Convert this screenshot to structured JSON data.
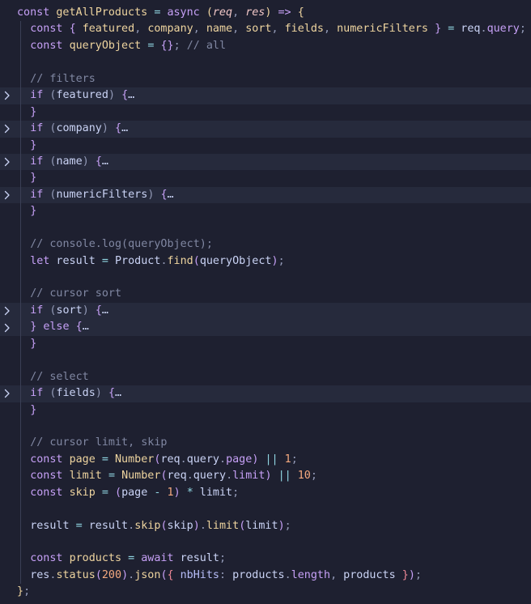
{
  "colors": {
    "background": "#1e2030",
    "keyword": "#c6a0f6",
    "function": "#eed49f",
    "comment": "#8087a2",
    "number": "#f5a97f",
    "text": "#cad3f5"
  },
  "lines": [
    {
      "folded": false,
      "guide": false,
      "indent": 0,
      "tokens": [
        [
          "t-keyword",
          "const"
        ],
        [
          "t-plain",
          " "
        ],
        [
          "t-func",
          "getAllProducts"
        ],
        [
          "t-plain",
          " "
        ],
        [
          "t-op",
          "="
        ],
        [
          "t-plain",
          " "
        ],
        [
          "t-keyword",
          "async"
        ],
        [
          "t-plain",
          " "
        ],
        [
          "t-brace-top",
          "("
        ],
        [
          "t-param",
          "req"
        ],
        [
          "t-punct",
          ", "
        ],
        [
          "t-param",
          "res"
        ],
        [
          "t-brace-top",
          ")"
        ],
        [
          "t-plain",
          " "
        ],
        [
          "t-keyword",
          "=>"
        ],
        [
          "t-plain",
          " "
        ],
        [
          "t-brace-top",
          "{"
        ]
      ]
    },
    {
      "folded": false,
      "guide": true,
      "indent": 1,
      "tokens": [
        [
          "t-keyword",
          "const"
        ],
        [
          "t-plain",
          " "
        ],
        [
          "t-brace",
          "{"
        ],
        [
          "t-plain",
          " "
        ],
        [
          "t-const-name",
          "featured"
        ],
        [
          "t-punct",
          ", "
        ],
        [
          "t-const-name",
          "company"
        ],
        [
          "t-punct",
          ", "
        ],
        [
          "t-const-name",
          "name"
        ],
        [
          "t-punct",
          ", "
        ],
        [
          "t-const-name",
          "sort"
        ],
        [
          "t-punct",
          ", "
        ],
        [
          "t-const-name",
          "fields"
        ],
        [
          "t-punct",
          ", "
        ],
        [
          "t-const-name",
          "numericFilters"
        ],
        [
          "t-plain",
          " "
        ],
        [
          "t-brace",
          "}"
        ],
        [
          "t-plain",
          " "
        ],
        [
          "t-op",
          "="
        ],
        [
          "t-plain",
          " req"
        ],
        [
          "t-punct",
          "."
        ],
        [
          "t-prop",
          "query"
        ],
        [
          "t-punct",
          ";"
        ]
      ]
    },
    {
      "folded": false,
      "guide": true,
      "indent": 1,
      "tokens": [
        [
          "t-keyword",
          "const"
        ],
        [
          "t-plain",
          " "
        ],
        [
          "t-const-name",
          "queryObject"
        ],
        [
          "t-plain",
          " "
        ],
        [
          "t-op",
          "="
        ],
        [
          "t-plain",
          " "
        ],
        [
          "t-brace",
          "{}"
        ],
        [
          "t-punct",
          ";"
        ],
        [
          "t-plain",
          " "
        ],
        [
          "t-comment",
          "// all"
        ]
      ]
    },
    {
      "folded": false,
      "guide": true,
      "indent": 1,
      "tokens": []
    },
    {
      "folded": false,
      "guide": true,
      "indent": 1,
      "tokens": [
        [
          "t-comment",
          "// filters"
        ]
      ]
    },
    {
      "folded": true,
      "guide": true,
      "indent": 1,
      "tokens": [
        [
          "t-keyword",
          "if"
        ],
        [
          "t-plain",
          " "
        ],
        [
          "t-punct",
          "("
        ],
        [
          "t-plain",
          "featured"
        ],
        [
          "t-punct",
          ")"
        ],
        [
          "t-plain",
          " "
        ],
        [
          "t-brace",
          "{"
        ],
        [
          "t-ellipsis",
          "…"
        ]
      ]
    },
    {
      "folded": false,
      "guide": true,
      "indent": 1,
      "tokens": [
        [
          "t-brace",
          "}"
        ]
      ]
    },
    {
      "folded": true,
      "guide": true,
      "indent": 1,
      "tokens": [
        [
          "t-keyword",
          "if"
        ],
        [
          "t-plain",
          " "
        ],
        [
          "t-punct",
          "("
        ],
        [
          "t-plain",
          "company"
        ],
        [
          "t-punct",
          ")"
        ],
        [
          "t-plain",
          " "
        ],
        [
          "t-brace",
          "{"
        ],
        [
          "t-ellipsis",
          "…"
        ]
      ]
    },
    {
      "folded": false,
      "guide": true,
      "indent": 1,
      "tokens": [
        [
          "t-brace",
          "}"
        ]
      ]
    },
    {
      "folded": true,
      "guide": true,
      "indent": 1,
      "tokens": [
        [
          "t-keyword",
          "if"
        ],
        [
          "t-plain",
          " "
        ],
        [
          "t-punct",
          "("
        ],
        [
          "t-plain",
          "name"
        ],
        [
          "t-punct",
          ")"
        ],
        [
          "t-plain",
          " "
        ],
        [
          "t-brace",
          "{"
        ],
        [
          "t-ellipsis",
          "…"
        ]
      ]
    },
    {
      "folded": false,
      "guide": true,
      "indent": 1,
      "tokens": [
        [
          "t-brace",
          "}"
        ]
      ]
    },
    {
      "folded": true,
      "guide": true,
      "indent": 1,
      "tokens": [
        [
          "t-keyword",
          "if"
        ],
        [
          "t-plain",
          " "
        ],
        [
          "t-punct",
          "("
        ],
        [
          "t-plain",
          "numericFilters"
        ],
        [
          "t-punct",
          ")"
        ],
        [
          "t-plain",
          " "
        ],
        [
          "t-brace",
          "{"
        ],
        [
          "t-ellipsis",
          "…"
        ]
      ]
    },
    {
      "folded": false,
      "guide": true,
      "indent": 1,
      "tokens": [
        [
          "t-brace",
          "}"
        ]
      ]
    },
    {
      "folded": false,
      "guide": true,
      "indent": 1,
      "tokens": []
    },
    {
      "folded": false,
      "guide": true,
      "indent": 1,
      "tokens": [
        [
          "t-comment",
          "// console.log(queryObject);"
        ]
      ]
    },
    {
      "folded": false,
      "guide": true,
      "indent": 1,
      "tokens": [
        [
          "t-keyword",
          "let"
        ],
        [
          "t-plain",
          " result "
        ],
        [
          "t-op",
          "="
        ],
        [
          "t-plain",
          " Product"
        ],
        [
          "t-punct",
          "."
        ],
        [
          "t-func",
          "find"
        ],
        [
          "t-brace",
          "("
        ],
        [
          "t-plain",
          "queryObject"
        ],
        [
          "t-brace",
          ")"
        ],
        [
          "t-punct",
          ";"
        ]
      ]
    },
    {
      "folded": false,
      "guide": true,
      "indent": 1,
      "tokens": []
    },
    {
      "folded": false,
      "guide": true,
      "indent": 1,
      "tokens": [
        [
          "t-comment",
          "// cursor sort"
        ]
      ]
    },
    {
      "folded": true,
      "guide": true,
      "indent": 1,
      "tokens": [
        [
          "t-keyword",
          "if"
        ],
        [
          "t-plain",
          " "
        ],
        [
          "t-punct",
          "("
        ],
        [
          "t-plain",
          "sort"
        ],
        [
          "t-punct",
          ")"
        ],
        [
          "t-plain",
          " "
        ],
        [
          "t-brace",
          "{"
        ],
        [
          "t-ellipsis",
          "…"
        ]
      ]
    },
    {
      "folded": true,
      "guide": true,
      "indent": 1,
      "tokens": [
        [
          "t-brace",
          "}"
        ],
        [
          "t-plain",
          " "
        ],
        [
          "t-keyword",
          "else"
        ],
        [
          "t-plain",
          " "
        ],
        [
          "t-brace",
          "{"
        ],
        [
          "t-ellipsis",
          "…"
        ]
      ]
    },
    {
      "folded": false,
      "guide": true,
      "indent": 1,
      "tokens": [
        [
          "t-brace",
          "}"
        ]
      ]
    },
    {
      "folded": false,
      "guide": true,
      "indent": 1,
      "tokens": []
    },
    {
      "folded": false,
      "guide": true,
      "indent": 1,
      "tokens": [
        [
          "t-comment",
          "// select"
        ]
      ]
    },
    {
      "folded": true,
      "guide": true,
      "indent": 1,
      "tokens": [
        [
          "t-keyword",
          "if"
        ],
        [
          "t-plain",
          " "
        ],
        [
          "t-punct",
          "("
        ],
        [
          "t-plain",
          "fields"
        ],
        [
          "t-punct",
          ")"
        ],
        [
          "t-plain",
          " "
        ],
        [
          "t-brace",
          "{"
        ],
        [
          "t-ellipsis",
          "…"
        ]
      ]
    },
    {
      "folded": false,
      "guide": true,
      "indent": 1,
      "tokens": [
        [
          "t-brace",
          "}"
        ]
      ]
    },
    {
      "folded": false,
      "guide": true,
      "indent": 1,
      "tokens": []
    },
    {
      "folded": false,
      "guide": true,
      "indent": 1,
      "tokens": [
        [
          "t-comment",
          "// cursor limit, skip"
        ]
      ]
    },
    {
      "folded": false,
      "guide": true,
      "indent": 1,
      "tokens": [
        [
          "t-keyword",
          "const"
        ],
        [
          "t-plain",
          " "
        ],
        [
          "t-const-name",
          "page"
        ],
        [
          "t-plain",
          " "
        ],
        [
          "t-op",
          "="
        ],
        [
          "t-plain",
          " "
        ],
        [
          "t-func",
          "Number"
        ],
        [
          "t-brace",
          "("
        ],
        [
          "t-plain",
          "req"
        ],
        [
          "t-punct",
          "."
        ],
        [
          "t-plain",
          "query"
        ],
        [
          "t-punct",
          "."
        ],
        [
          "t-prop",
          "page"
        ],
        [
          "t-brace",
          ")"
        ],
        [
          "t-plain",
          " "
        ],
        [
          "t-op",
          "||"
        ],
        [
          "t-plain",
          " "
        ],
        [
          "t-number",
          "1"
        ],
        [
          "t-punct",
          ";"
        ]
      ]
    },
    {
      "folded": false,
      "guide": true,
      "indent": 1,
      "tokens": [
        [
          "t-keyword",
          "const"
        ],
        [
          "t-plain",
          " "
        ],
        [
          "t-const-name",
          "limit"
        ],
        [
          "t-plain",
          " "
        ],
        [
          "t-op",
          "="
        ],
        [
          "t-plain",
          " "
        ],
        [
          "t-func",
          "Number"
        ],
        [
          "t-brace",
          "("
        ],
        [
          "t-plain",
          "req"
        ],
        [
          "t-punct",
          "."
        ],
        [
          "t-plain",
          "query"
        ],
        [
          "t-punct",
          "."
        ],
        [
          "t-prop",
          "limit"
        ],
        [
          "t-brace",
          ")"
        ],
        [
          "t-plain",
          " "
        ],
        [
          "t-op",
          "||"
        ],
        [
          "t-plain",
          " "
        ],
        [
          "t-number",
          "10"
        ],
        [
          "t-punct",
          ";"
        ]
      ]
    },
    {
      "folded": false,
      "guide": true,
      "indent": 1,
      "tokens": [
        [
          "t-keyword",
          "const"
        ],
        [
          "t-plain",
          " "
        ],
        [
          "t-const-name",
          "skip"
        ],
        [
          "t-plain",
          " "
        ],
        [
          "t-op",
          "="
        ],
        [
          "t-plain",
          " "
        ],
        [
          "t-brace",
          "("
        ],
        [
          "t-plain",
          "page "
        ],
        [
          "t-op",
          "-"
        ],
        [
          "t-plain",
          " "
        ],
        [
          "t-number",
          "1"
        ],
        [
          "t-brace",
          ")"
        ],
        [
          "t-plain",
          " "
        ],
        [
          "t-op",
          "*"
        ],
        [
          "t-plain",
          " limit"
        ],
        [
          "t-punct",
          ";"
        ]
      ]
    },
    {
      "folded": false,
      "guide": true,
      "indent": 1,
      "tokens": []
    },
    {
      "folded": false,
      "guide": true,
      "indent": 1,
      "tokens": [
        [
          "t-plain",
          "result "
        ],
        [
          "t-op",
          "="
        ],
        [
          "t-plain",
          " result"
        ],
        [
          "t-punct",
          "."
        ],
        [
          "t-func",
          "skip"
        ],
        [
          "t-brace",
          "("
        ],
        [
          "t-plain",
          "skip"
        ],
        [
          "t-brace",
          ")"
        ],
        [
          "t-punct",
          "."
        ],
        [
          "t-func",
          "limit"
        ],
        [
          "t-brace",
          "("
        ],
        [
          "t-plain",
          "limit"
        ],
        [
          "t-brace",
          ")"
        ],
        [
          "t-punct",
          ";"
        ]
      ]
    },
    {
      "folded": false,
      "guide": true,
      "indent": 1,
      "tokens": []
    },
    {
      "folded": false,
      "guide": true,
      "indent": 1,
      "tokens": [
        [
          "t-keyword",
          "const"
        ],
        [
          "t-plain",
          " "
        ],
        [
          "t-const-name",
          "products"
        ],
        [
          "t-plain",
          " "
        ],
        [
          "t-op",
          "="
        ],
        [
          "t-plain",
          " "
        ],
        [
          "t-keyword",
          "await"
        ],
        [
          "t-plain",
          " result"
        ],
        [
          "t-punct",
          ";"
        ]
      ]
    },
    {
      "folded": false,
      "guide": true,
      "indent": 1,
      "tokens": [
        [
          "t-plain",
          "res"
        ],
        [
          "t-punct",
          "."
        ],
        [
          "t-func",
          "status"
        ],
        [
          "t-brace",
          "("
        ],
        [
          "t-number",
          "200"
        ],
        [
          "t-brace",
          ")"
        ],
        [
          "t-punct",
          "."
        ],
        [
          "t-func",
          "json"
        ],
        [
          "t-brace",
          "("
        ],
        [
          "t-brace2",
          "{"
        ],
        [
          "t-plain",
          " "
        ],
        [
          "t-prop2",
          "nbHits"
        ],
        [
          "t-punct",
          ":"
        ],
        [
          "t-plain",
          " products"
        ],
        [
          "t-punct",
          "."
        ],
        [
          "t-prop",
          "length"
        ],
        [
          "t-punct",
          ","
        ],
        [
          "t-plain",
          " products "
        ],
        [
          "t-brace2",
          "}"
        ],
        [
          "t-brace",
          ")"
        ],
        [
          "t-punct",
          ";"
        ]
      ]
    },
    {
      "folded": false,
      "guide": false,
      "indent": 0,
      "tokens": [
        [
          "t-brace-top",
          "}"
        ],
        [
          "t-punct",
          ";"
        ]
      ]
    }
  ]
}
